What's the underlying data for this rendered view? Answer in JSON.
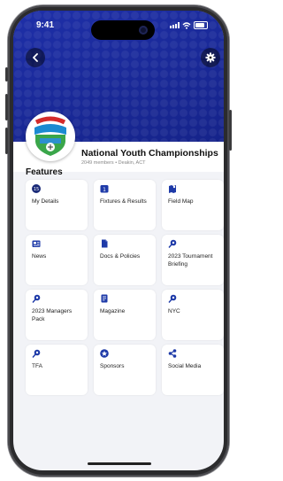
{
  "status_bar": {
    "time": "9:41"
  },
  "club": {
    "name": "National Youth Championships",
    "meta": "2049 members • Deakin, ACT"
  },
  "features_heading": "Features",
  "tiles": [
    {
      "label": "My Details",
      "icon": "user-badge-icon"
    },
    {
      "label": "Fixtures & Results",
      "icon": "calendar-icon"
    },
    {
      "label": "Field Map",
      "icon": "map-icon"
    },
    {
      "label": "News",
      "icon": "newspaper-icon"
    },
    {
      "label": "Docs & Policies",
      "icon": "document-icon"
    },
    {
      "label": "2023 Tournament Briefing",
      "icon": "pin-icon"
    },
    {
      "label": "2023 Managers Pack",
      "icon": "pin-icon"
    },
    {
      "label": "Magazine",
      "icon": "magazine-icon"
    },
    {
      "label": "NYC",
      "icon": "pin-icon"
    },
    {
      "label": "TFA",
      "icon": "pin-icon"
    },
    {
      "label": "Sponsors",
      "icon": "star-icon"
    },
    {
      "label": "Social Media",
      "icon": "share-icon"
    }
  ],
  "colors": {
    "brand": "#1a2a9a",
    "icon": "#1e3aa8"
  }
}
